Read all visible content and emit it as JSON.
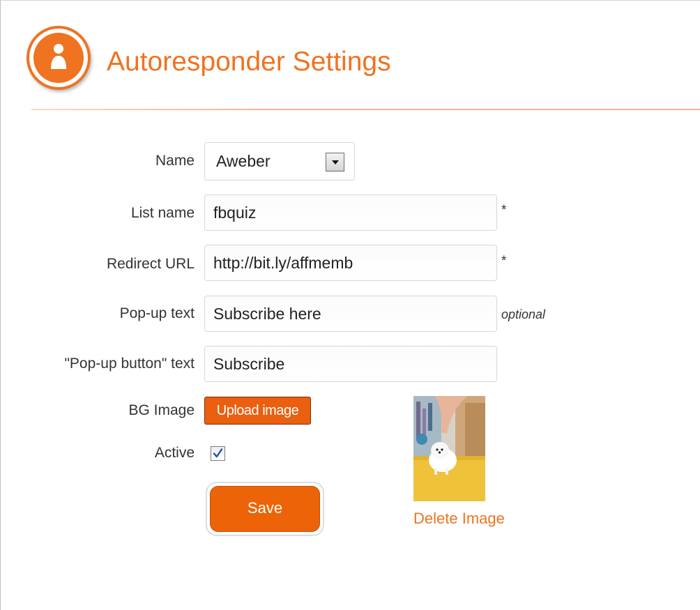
{
  "header": {
    "title": "Autoresponder Settings",
    "icon": "user-icon",
    "accent_color": "#ef7321"
  },
  "form": {
    "name": {
      "label": "Name",
      "value": "Aweber"
    },
    "list_name": {
      "label": "List name",
      "value": "fbquiz",
      "hint": "*"
    },
    "redirect_url": {
      "label": "Redirect URL",
      "value": "http://bit.ly/affmemb",
      "hint": "*"
    },
    "popup_text": {
      "label": "Pop-up text",
      "value": "Subscribe here",
      "hint": "optional"
    },
    "popup_button_text": {
      "label": "\"Pop-up button\" text",
      "value": "Subscribe"
    },
    "bg_image": {
      "label": "BG Image",
      "upload_label": "Upload image",
      "delete_label": "Delete Image"
    },
    "active": {
      "label": "Active",
      "checked": true
    },
    "save_label": "Save"
  }
}
